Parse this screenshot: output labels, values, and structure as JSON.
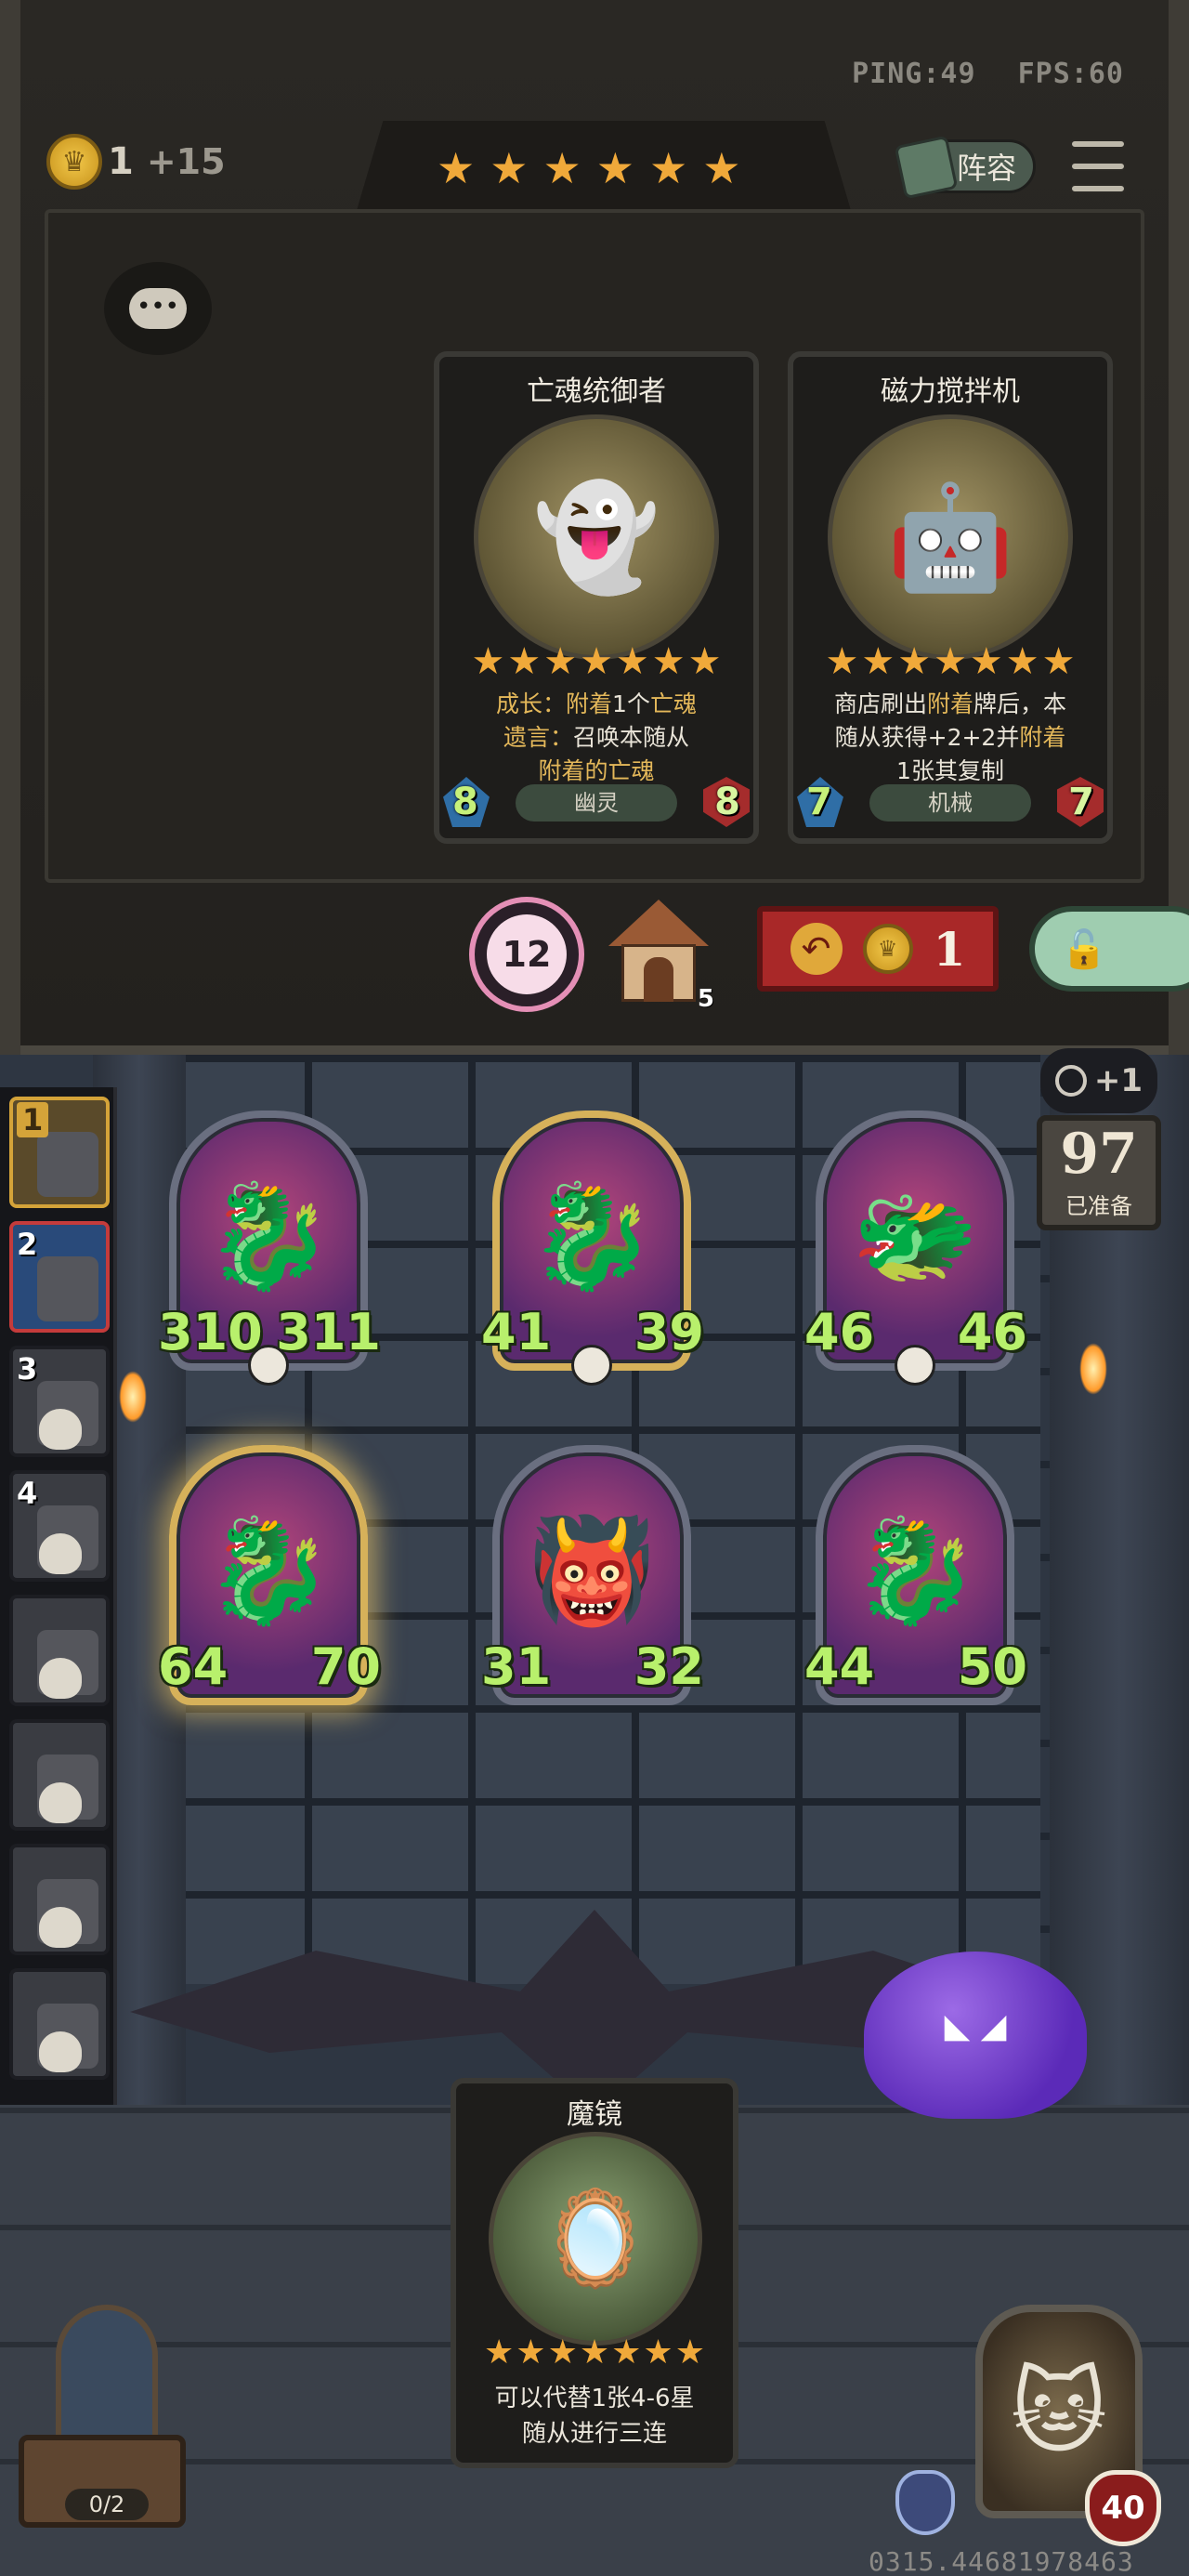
{
  "status": {
    "ping": "PING:49",
    "fps": "FPS:60"
  },
  "resources": {
    "gold": "1",
    "income": "+15"
  },
  "tavern": {
    "tier_stars": 6
  },
  "lineup_button": "阵容",
  "chat_icon": "chat-bubble-icon",
  "shop_cards": [
    {
      "name": "亡魂统御者",
      "stars": 7,
      "effect_lines": [
        [
          {
            "t": "成长：",
            "h": true
          },
          {
            "t": "附着",
            "h": true
          },
          {
            "t": "1个",
            "h": false
          },
          {
            "t": "亡魂",
            "h": true
          }
        ],
        [
          {
            "t": "遗言：",
            "h": true
          },
          {
            "t": "召唤本随从",
            "h": false
          }
        ],
        [
          {
            "t": "附着的",
            "h": true
          },
          {
            "t": "亡魂",
            "h": true
          }
        ]
      ],
      "attack": "8",
      "health": "8",
      "tribe": "幽灵"
    },
    {
      "name": "磁力搅拌机",
      "stars": 7,
      "effect_lines": [
        [
          {
            "t": "商店刷出",
            "h": false
          },
          {
            "t": "附着",
            "h": true
          },
          {
            "t": "牌后，本",
            "h": false
          }
        ],
        [
          {
            "t": "随从获得",
            "h": false
          },
          {
            "t": "+2+2",
            "h": false
          },
          {
            "t": "并",
            "h": false
          },
          {
            "t": "附着",
            "h": true
          }
        ],
        [
          {
            "t": "1张其复制",
            "h": false
          }
        ]
      ],
      "attack": "7",
      "health": "7",
      "tribe": "机械"
    }
  ],
  "shop_controls": {
    "refresh_count": "12",
    "house_count": "5",
    "reroll_cost": "1"
  },
  "sidebar_players": [
    {
      "rank": "1",
      "alive": true
    },
    {
      "rank": "2",
      "alive": true
    },
    {
      "rank": "3",
      "alive": false
    },
    {
      "rank": "4",
      "alive": false
    },
    {
      "rank": "",
      "alive": false
    },
    {
      "rank": "",
      "alive": false
    },
    {
      "rank": "",
      "alive": false
    },
    {
      "rank": "",
      "alive": false
    }
  ],
  "board_minions": [
    {
      "attack": "310",
      "health": "311",
      "golden": false,
      "selected": false
    },
    {
      "attack": "41",
      "health": "39",
      "golden": true,
      "selected": false
    },
    {
      "attack": "46",
      "health": "46",
      "golden": false,
      "selected": false
    },
    {
      "attack": "64",
      "health": "70",
      "golden": true,
      "selected": true
    },
    {
      "attack": "31",
      "health": "32",
      "golden": false,
      "selected": false
    },
    {
      "attack": "44",
      "health": "50",
      "golden": false,
      "selected": false
    }
  ],
  "round": {
    "bonus": "+1",
    "ready_count": "97",
    "ready_label": "已准备"
  },
  "hand_card": {
    "name": "魔镜",
    "stars": 7,
    "effect_line1": "可以代替1张4-6星",
    "effect_line2": "随从进行三连"
  },
  "chest": {
    "count": "0/2"
  },
  "hero": {
    "health": "40"
  },
  "seed": "0315.44681978463",
  "colors": {
    "star": "#f0a93a",
    "highlight": "#e4b85a",
    "stat_green": "#b8f06c",
    "reroll_red": "#a92828"
  }
}
